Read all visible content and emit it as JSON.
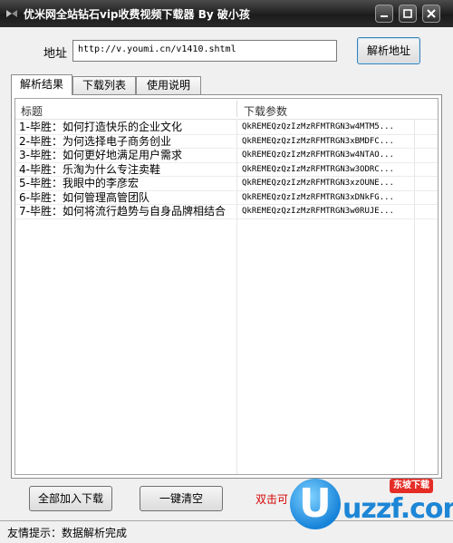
{
  "window": {
    "title": "优米网全站钻石vip收费视频下载器 By 破小孩"
  },
  "address": {
    "label": "地址",
    "value": "http://v.youmi.cn/v1410.shtml",
    "parse_button": "解析地址"
  },
  "tabs": [
    {
      "label": "解析结果",
      "active": true
    },
    {
      "label": "下载列表",
      "active": false
    },
    {
      "label": "使用说明",
      "active": false
    }
  ],
  "table": {
    "columns": [
      "标题",
      "下载参数"
    ],
    "rows": [
      {
        "title": "1-毕胜：如何打造快乐的企业文化",
        "param": "QkREMEQzQzIzMzRFMTRGN3w4MTM5..."
      },
      {
        "title": "2-毕胜：为何选择电子商务创业",
        "param": "QkREMEQzQzIzMzRFMTRGN3xBMDFC..."
      },
      {
        "title": "3-毕胜：如何更好地满足用户需求",
        "param": "QkREMEQzQzIzMzRFMTRGN3w4NTAO..."
      },
      {
        "title": "4-毕胜：乐淘为什么专注卖鞋",
        "param": "QkREMEQzQzIzMzRFMTRGN3w3ODRC..."
      },
      {
        "title": "5-毕胜：我眼中的李彦宏",
        "param": "QkREMEQzQzIzMzRFMTRGN3xzOUNE..."
      },
      {
        "title": "6-毕胜：如何管理高管团队",
        "param": "QkREMEQzQzIzMzRFMTRGN3xDNkFG..."
      },
      {
        "title": "7-毕胜：如何将流行趋势与自身品牌相结合",
        "param": "QkREMEQzQzIzMzRFMTRGN3w0RUJE..."
      }
    ]
  },
  "actions": {
    "add_all": "全部加入下载",
    "clear": "一键清空",
    "hint": "双击可"
  },
  "status": {
    "text": "友情提示：数据解析完成"
  },
  "watermark": {
    "badge": "东坡下载",
    "site": "uzzf.com",
    "letter": "U"
  },
  "colors": {
    "titlebar": "#2a2a2a",
    "hint": "#d40000",
    "watermark": "#1d86d6"
  }
}
